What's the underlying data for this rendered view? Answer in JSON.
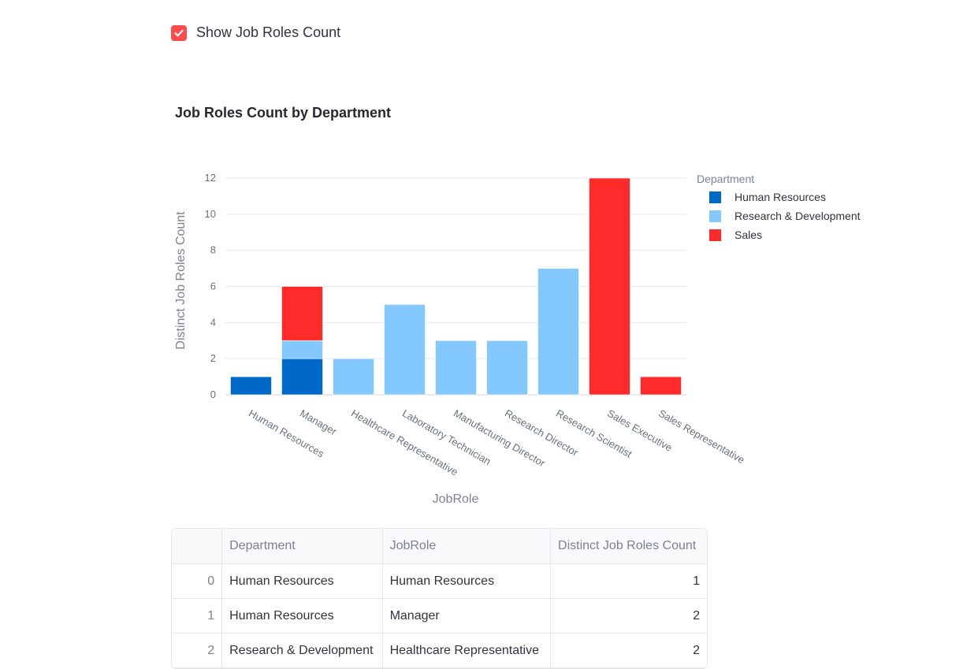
{
  "checkbox": {
    "label": "Show Job Roles Count",
    "checked": true,
    "color": "#ff4b4b"
  },
  "chart_data": {
    "type": "bar",
    "stacked": true,
    "title": "Job Roles Count by Department",
    "xlabel": "JobRole",
    "ylabel": "Distinct Job Roles Count",
    "ylim": [
      0,
      12
    ],
    "yticks": [
      0,
      2,
      4,
      6,
      8,
      10,
      12
    ],
    "grid": true,
    "legend_title": "Department",
    "legend_position": "top-right",
    "categories": [
      "Human Resources",
      "Manager",
      "Healthcare Representative",
      "Laboratory Technician",
      "Manufacturing Director",
      "Research Director",
      "Research Scientist",
      "Sales Executive",
      "Sales Representative"
    ],
    "series": [
      {
        "name": "Human Resources",
        "color": "#0068c9",
        "values": [
          1,
          2,
          0,
          0,
          0,
          0,
          0,
          0,
          0
        ]
      },
      {
        "name": "Research & Development",
        "color": "#83c9ff",
        "values": [
          0,
          1,
          2,
          5,
          3,
          3,
          7,
          0,
          0
        ]
      },
      {
        "name": "Sales",
        "color": "#ff2b2b",
        "values": [
          0,
          3,
          0,
          0,
          0,
          0,
          0,
          12,
          1
        ]
      }
    ]
  },
  "table": {
    "columns": [
      "",
      "Department",
      "JobRole",
      "Distinct Job Roles Count"
    ],
    "rows": [
      [
        "0",
        "Human Resources",
        "Human Resources",
        "1"
      ],
      [
        "1",
        "Human Resources",
        "Manager",
        "2"
      ],
      [
        "2",
        "Research & Development",
        "Healthcare Representative",
        "2"
      ]
    ]
  }
}
